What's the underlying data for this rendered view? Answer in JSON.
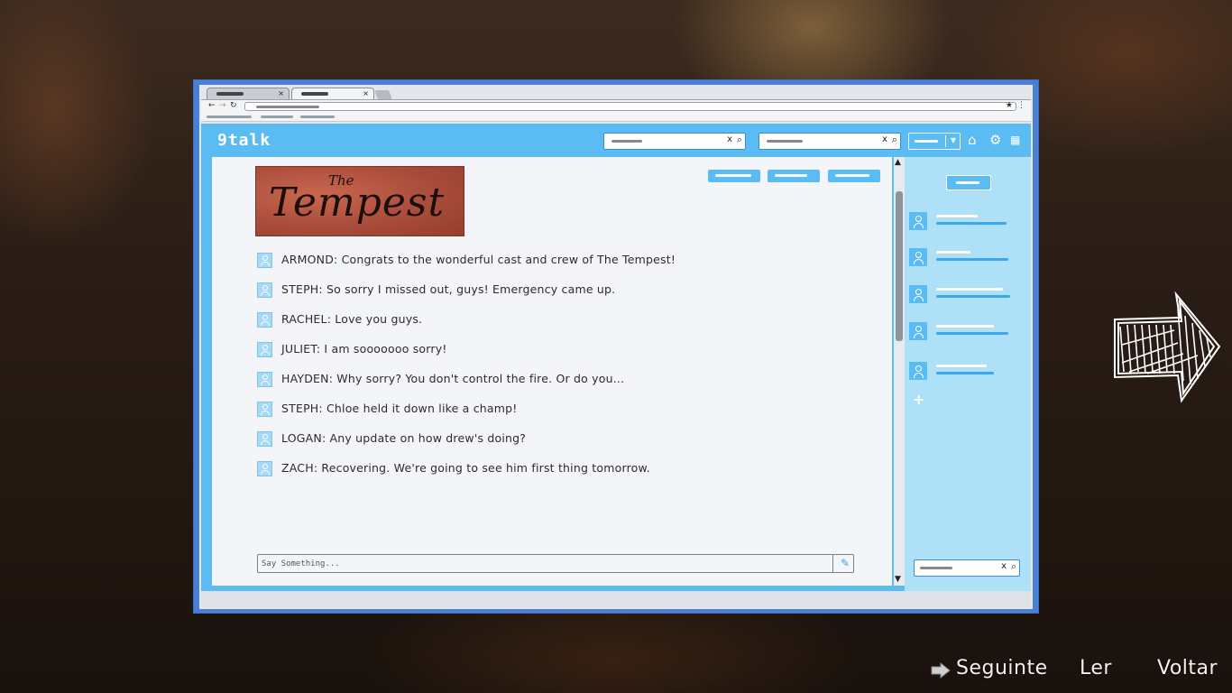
{
  "browser": {
    "tabs": [
      {
        "label": "",
        "close": "×"
      },
      {
        "label": "",
        "close": "×"
      }
    ]
  },
  "app": {
    "brand": "9talk",
    "search_clear": "x",
    "show_title": [
      "The",
      "Tempest"
    ],
    "compose_placeholder": "Say Something..."
  },
  "messages": [
    {
      "text": "ARMOND: Congrats to the wonderful cast and crew of The Tempest!"
    },
    {
      "text": "STEPH: So sorry I missed out, guys! Emergency came up."
    },
    {
      "text": "RACHEL: Love you guys."
    },
    {
      "text": "JULIET: I am sooooooo sorry!"
    },
    {
      "text": "HAYDEN: Why sorry? You don't control the fire. Or do you..."
    },
    {
      "text": "STEPH: Chloe held it down like a champ!"
    },
    {
      "text": "LOGAN: Any update on how drew's doing?"
    },
    {
      "text": "ZACH: Recovering. We're going to see him first thing tomorrow."
    }
  ],
  "sidebar": {
    "add_label": "+"
  },
  "footer": {
    "next": "Seguinte",
    "read": "Ler",
    "back": "Voltar"
  },
  "icons": {
    "home": "home-icon",
    "settings": "gear-icon",
    "apps": "grid-icon",
    "search": "search-icon",
    "attach": "paperclip-icon",
    "next": "arrow-right-icon"
  },
  "colors": {
    "accent": "#5bbcf4",
    "window_frame": "#4a7fd6",
    "sidebar": "#aee0f8",
    "logo_red": "#b0503e"
  }
}
